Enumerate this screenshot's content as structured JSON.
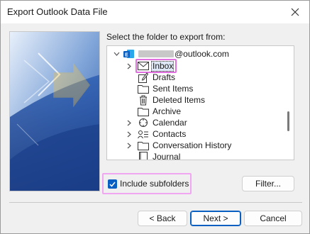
{
  "window": {
    "title": "Export Outlook Data File",
    "close_glyph": "✕"
  },
  "prompt": {
    "text": "Select the folder to export from:"
  },
  "tree": {
    "account_suffix": "@outlook.com",
    "account_icon": "exchange-account-icon",
    "items": [
      {
        "label": "Inbox",
        "icon": "mail-icon",
        "expandable": true,
        "selected": true
      },
      {
        "label": "Drafts",
        "icon": "drafts-icon",
        "expandable": false
      },
      {
        "label": "Sent Items",
        "icon": "folder-icon",
        "expandable": false
      },
      {
        "label": "Deleted Items",
        "icon": "trash-icon",
        "expandable": false
      },
      {
        "label": "Archive",
        "icon": "folder-icon",
        "expandable": false
      },
      {
        "label": "Calendar",
        "icon": "calendar-icon",
        "expandable": true
      },
      {
        "label": "Contacts",
        "icon": "contacts-icon",
        "expandable": true
      },
      {
        "label": "Conversation History",
        "icon": "folder-icon",
        "expandable": true
      },
      {
        "label": "Journal",
        "icon": "journal-icon",
        "expandable": false
      }
    ]
  },
  "include_subfolders": {
    "label": "Include subfolders",
    "checked": true
  },
  "buttons": {
    "filter": "Filter...",
    "back": "< Back",
    "next": "Next >",
    "cancel": "Cancel"
  },
  "colors": {
    "accent": "#0a5fc2",
    "highlight": "#e06fe0"
  }
}
